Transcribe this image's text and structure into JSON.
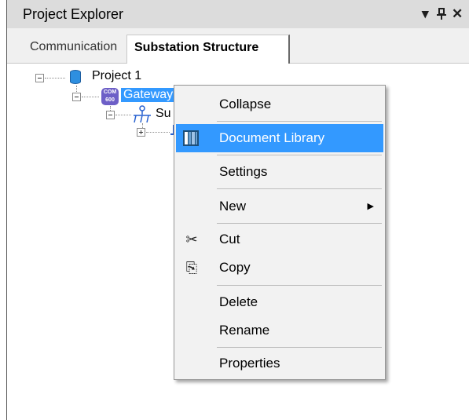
{
  "panel": {
    "title": "Project Explorer",
    "pin_icon": "pin-icon",
    "close_icon": "close-icon",
    "dropdown_icon": "dropdown-icon",
    "title_glyph_dropdown": "▾",
    "title_glyph_pin": "ᵠ",
    "title_glyph_close": "✕"
  },
  "tabs": [
    {
      "label": "Communication",
      "active": false
    },
    {
      "label": "Substation Structure",
      "active": true
    }
  ],
  "tree": {
    "project": {
      "label": "Project 1",
      "icon": "database-icon"
    },
    "gateway": {
      "label": "Gateway",
      "icon": "gateway-icon",
      "icon_text_top": "COM",
      "icon_text_bottom": "600",
      "selected": true
    },
    "substation": {
      "label": "Su",
      "icon": "substation-icon"
    },
    "child": {
      "icon": "bay-icon"
    }
  },
  "context_menu": {
    "items": [
      {
        "label": "Collapse"
      },
      {
        "label": "Document Library",
        "icon": "document-library-icon",
        "highlighted": true
      },
      {
        "label": "Settings"
      },
      {
        "label": "New",
        "has_submenu": true,
        "arrow": "▶"
      },
      {
        "label": "Cut",
        "icon": "scissors-icon",
        "glyph": "✂"
      },
      {
        "label": "Copy",
        "icon": "copy-icon",
        "glyph": "⎘"
      },
      {
        "label": "Delete"
      },
      {
        "label": "Rename"
      },
      {
        "label": "Properties"
      }
    ]
  },
  "colors": {
    "selection": "#3399ff",
    "titlebar": "#dcdcdc",
    "menu_bg": "#f2f2f2"
  }
}
